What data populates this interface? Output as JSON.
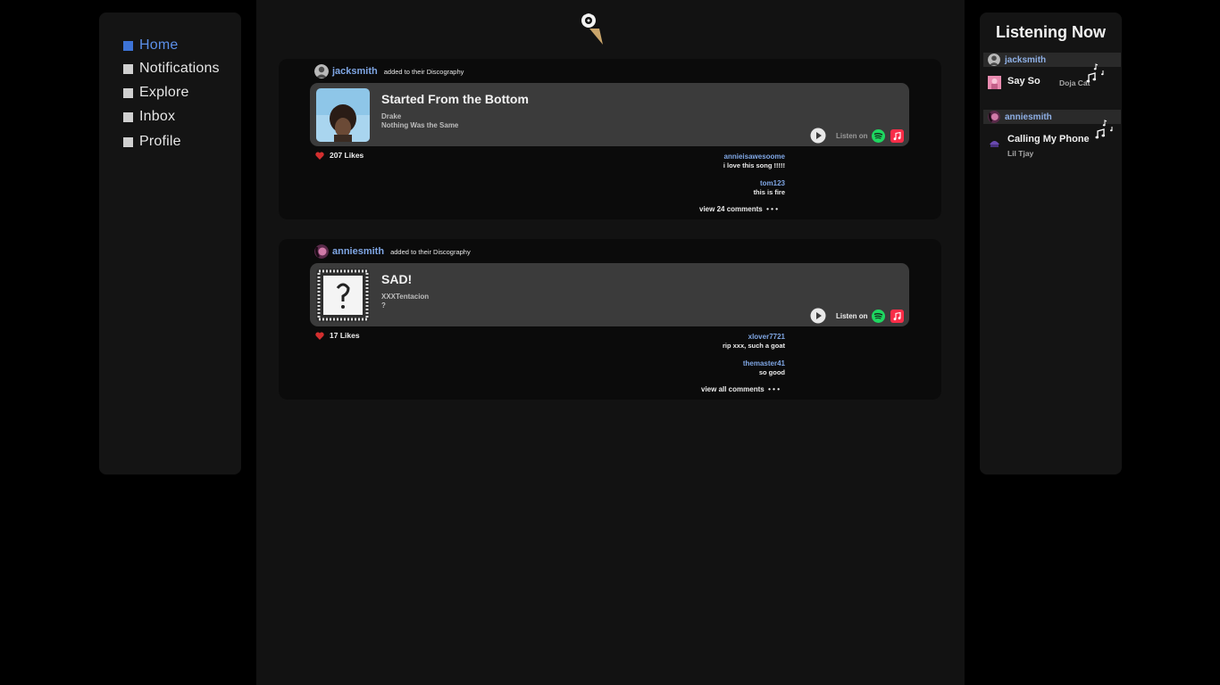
{
  "nav": {
    "items": [
      {
        "label": "Home",
        "active": true
      },
      {
        "label": "Notifications",
        "active": false
      },
      {
        "label": "Explore",
        "active": false
      },
      {
        "label": "Inbox",
        "active": false
      },
      {
        "label": "Profile",
        "active": false
      }
    ]
  },
  "feed": [
    {
      "user": "jacksmith",
      "action": "added to their Discography",
      "song": {
        "title": "Started From the Bottom",
        "artist": "Drake",
        "album": "Nothing Was the Same"
      },
      "listen_label": "Listen on",
      "likes": "207 Likes",
      "comments": [
        {
          "user": "annieisawesoome",
          "text": "i love this song !!!!!"
        },
        {
          "user": "tom123",
          "text": "this is fire"
        }
      ],
      "view_all": "view 24 comments"
    },
    {
      "user": "anniesmith",
      "action": "added to their Discography",
      "song": {
        "title": "SAD!",
        "artist": "XXXTentacion",
        "album": "?"
      },
      "listen_label": "Listen on",
      "likes": "17 Likes",
      "comments": [
        {
          "user": "xlover7721",
          "text": "rip xxx, such a goat"
        },
        {
          "user": "themaster41",
          "text": "so good"
        }
      ],
      "view_all": "view all comments"
    }
  ],
  "listening_now": {
    "title": "Listening Now",
    "entries": [
      {
        "user": "jacksmith",
        "song": "Say So",
        "artist": "Doja Cat"
      },
      {
        "user": "anniesmith",
        "song": "Calling My Phone",
        "artist": "Lil Tjay"
      }
    ]
  },
  "colors": {
    "accent": "#5b8fe8",
    "username": "#7fa6e4",
    "spotify": "#1ed760",
    "apple_music": "#fa2d48",
    "heart": "#d32f2f"
  }
}
